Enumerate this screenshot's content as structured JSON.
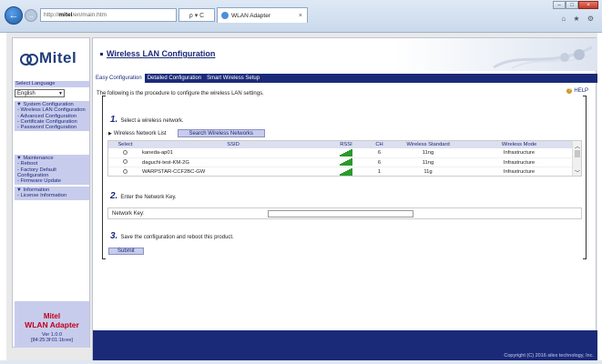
{
  "browser": {
    "url_prefix": "http://",
    "url_host": "mitel",
    "url_path": "/en/main.htm",
    "addr_tools": "ρ ▾ C",
    "tab_title": "WLAN Adapter",
    "tab_close": "×",
    "back_icon": "←",
    "fwd_icon": "→",
    "home_star": "⌂ ★ ⚙",
    "win_min": "–",
    "win_max": "□",
    "win_close": "×"
  },
  "sidebar": {
    "logo": "Mitel",
    "language_label": "Select Language",
    "language_value": "English",
    "system_head": "▼ System Configuration",
    "system_items": [
      "- Wireless LAN Configuration",
      "- Advanced Configuration",
      "- Certificate Configuration",
      "- Password Configuration"
    ],
    "maintenance_head": "▼ Maintenance",
    "maintenance_items": [
      "- Reboot",
      "- Factory Default Configuration",
      "- Firmware Update"
    ],
    "information_head": "▼ Information",
    "information_items": [
      "- License Information"
    ],
    "footer_brand": "Mitel",
    "footer_product": "WLAN Adapter",
    "footer_version": "Ver 1.0.0",
    "footer_mac": "[84:25:3f:01:1b:ee]"
  },
  "main": {
    "title": "Wireless LAN Configuration",
    "tabs": [
      "Easy Configuration",
      "Detailed Configuration",
      "Smart Wireless Setup"
    ],
    "intro": "The following is the procedure to configure the wireless LAN settings.",
    "help": "HELP",
    "step1_num": "1.",
    "step1_text": "Select a wireless network.",
    "wlist_label": "Wireless Network List",
    "search_button": "Search Wireless Networks",
    "table_headers": [
      "Select",
      "SSID",
      "RSSI",
      "CH",
      "Wireless Standard",
      "Wireless Mode"
    ],
    "networks": [
      {
        "ssid": "kaneda-ap01",
        "ch": "6",
        "standard": "11ng",
        "mode": "Infrastructure"
      },
      {
        "ssid": "daguchi-test-KM-2G",
        "ch": "6",
        "standard": "11ng",
        "mode": "Infrastructure"
      },
      {
        "ssid": "WARPSTAR-CCF2BC-GW",
        "ch": "1",
        "standard": "11g",
        "mode": "Infrastructure"
      }
    ],
    "step2_num": "2.",
    "step2_text": "Enter the Network Key.",
    "key_label": "Network Key:",
    "key_value": "",
    "step3_num": "3.",
    "step3_text": "Save the configuration and reboot this product.",
    "submit": "Submit",
    "copyright": "Copyright (C) 2016 silex technology, Inc."
  },
  "colors": {
    "nav": "#1b2a78",
    "menu_bg": "#c8ccec",
    "accent": "#c0001a",
    "rssi": "#2a9a2a"
  }
}
